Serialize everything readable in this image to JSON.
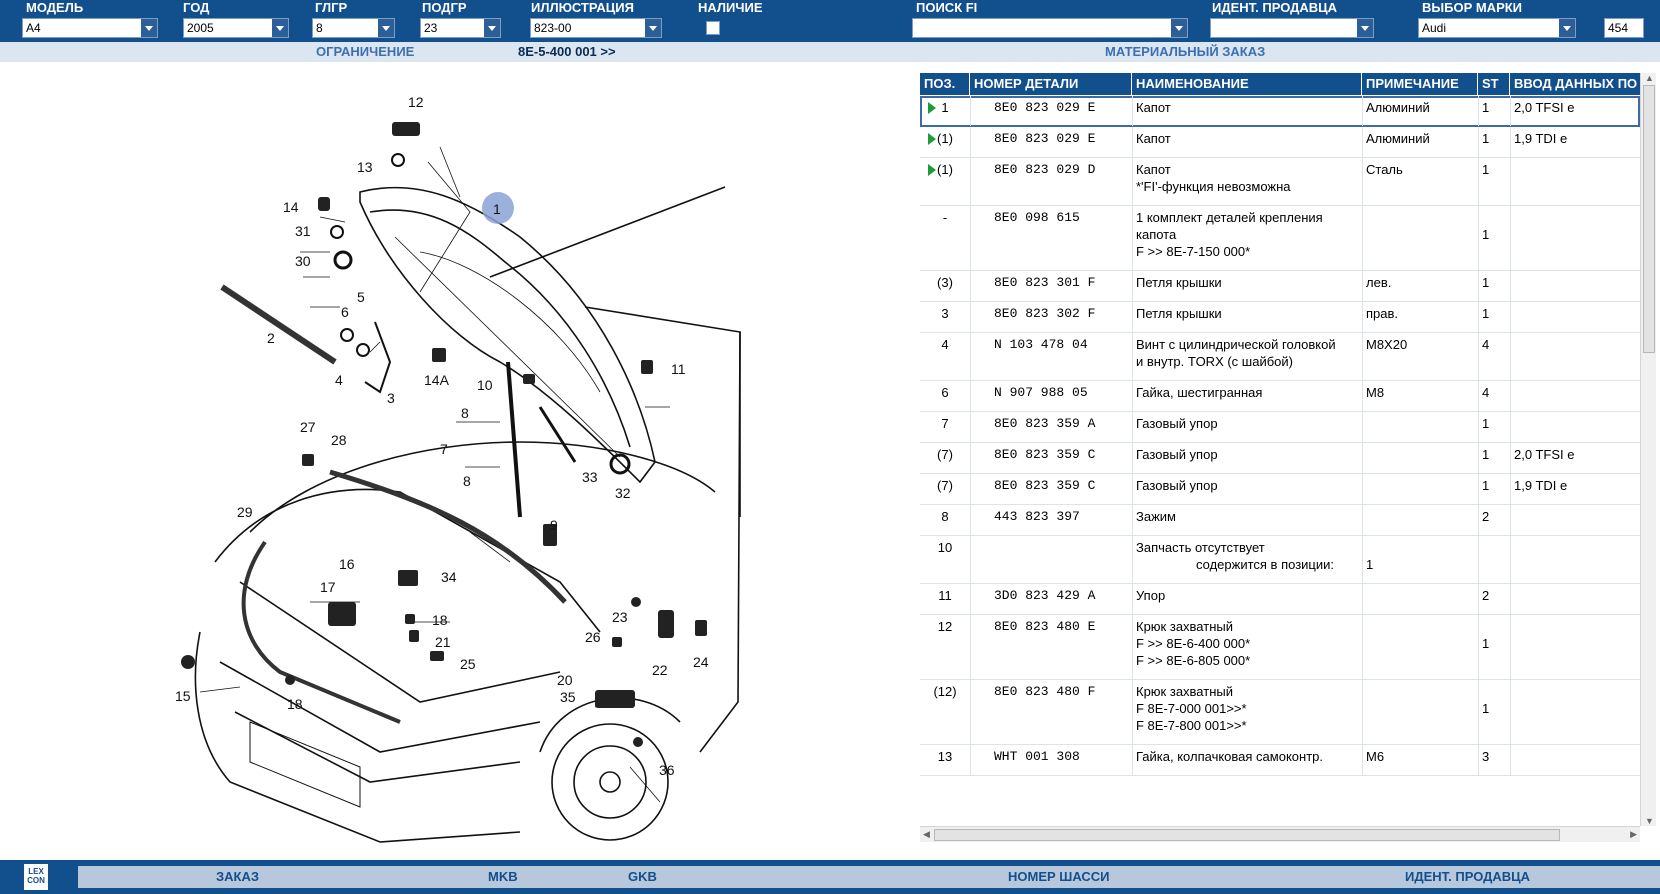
{
  "filters": {
    "model": {
      "label": "МОДЕЛЬ",
      "value": "A4"
    },
    "year": {
      "label": "ГОД",
      "value": "2005"
    },
    "main_group": {
      "label": "ГЛГР",
      "value": "8"
    },
    "sub_group": {
      "label": "ПОДГР",
      "value": "23"
    },
    "illustration": {
      "label": "ИЛЛЮСТРАЦИЯ",
      "value": "823-00"
    },
    "availability": {
      "label": "НАЛИЧИЕ"
    },
    "search_fi": {
      "label": "ПОИСК FI",
      "value": ""
    },
    "dealer_id": {
      "label": "ИДЕНТ. ПРОДАВЦА",
      "value": ""
    },
    "brand": {
      "label": "ВЫБОР МАРКИ",
      "value": "Audi"
    },
    "brand_code": "454"
  },
  "subheader": {
    "restriction_label": "ОГРАНИЧЕНИЕ",
    "restriction_value": "8E-5-400 001 >>",
    "order_title": "МАТЕРИАЛЬНЫЙ ЗАКАЗ"
  },
  "illustration": {
    "callouts": [
      "1",
      "2",
      "3",
      "4",
      "5",
      "6",
      "7",
      "8",
      "8",
      "9",
      "10",
      "11",
      "12",
      "13",
      "14",
      "14A",
      "15",
      "16",
      "17",
      "18",
      "18",
      "20",
      "21",
      "22",
      "23",
      "24",
      "25",
      "26",
      "27",
      "28",
      "29",
      "30",
      "31",
      "32",
      "33",
      "34",
      "35",
      "36"
    ]
  },
  "table": {
    "columns": [
      "ПОЗ.",
      "НОМЕР ДЕТАЛИ",
      "НАИМЕНОВАНИЕ",
      "ПРИМЕЧАНИЕ",
      "ST",
      "ВВОД ДАННЫХ ПО"
    ],
    "rows": [
      {
        "pos": "1",
        "pn": "8E0 823 029 E",
        "name": [
          "Капот"
        ],
        "note": "Алюминий",
        "st": "1",
        "input": "2,0 TFSI e",
        "marker": true
      },
      {
        "pos": "(1)",
        "pn": "8E0 823 029 E",
        "name": [
          "Капот"
        ],
        "note": "Алюминий",
        "st": "1",
        "input": "1,9 TDI e",
        "marker": true
      },
      {
        "pos": "(1)",
        "pn": "8E0 823 029 D",
        "name": [
          "Капот",
          "*'FI'-функция невозможна"
        ],
        "note": "Сталь",
        "st": "1",
        "input": "",
        "marker": true
      },
      {
        "pos": "-",
        "pn": "8E0 098 615",
        "name": [
          "1 комплект деталей крепления",
          "капота",
          "F            >> 8E-7-150 000*"
        ],
        "note": "",
        "st": "1",
        "input": "",
        "marker": false
      },
      {
        "pos": "(3)",
        "pn": "8E0 823 301 F",
        "name": [
          "Петля крышки"
        ],
        "note": "лев.",
        "st": "1",
        "input": "",
        "marker": false
      },
      {
        "pos": "3",
        "pn": "8E0 823 302 F",
        "name": [
          "Петля крышки"
        ],
        "note": "прав.",
        "st": "1",
        "input": "",
        "marker": false
      },
      {
        "pos": "4",
        "pn": "N   103 478 04",
        "name": [
          "Винт с цилиндрической головкой",
          "и внутр. TORX (с шайбой)"
        ],
        "note": "M8X20",
        "st": "4",
        "input": "",
        "marker": false
      },
      {
        "pos": "6",
        "pn": "N   907 988 05",
        "name": [
          "Гайка, шестигранная"
        ],
        "note": "M8",
        "st": "4",
        "input": "",
        "marker": false
      },
      {
        "pos": "7",
        "pn": "8E0 823 359 A",
        "name": [
          "Газовый упор"
        ],
        "note": "",
        "st": "1",
        "input": "",
        "marker": false
      },
      {
        "pos": "(7)",
        "pn": "8E0 823 359 C",
        "name": [
          "Газовый упор"
        ],
        "note": "",
        "st": "1",
        "input": "2,0 TFSI e",
        "marker": false
      },
      {
        "pos": "(7)",
        "pn": "8E0 823 359 C",
        "name": [
          "Газовый упор"
        ],
        "note": "",
        "st": "1",
        "input": "1,9 TDI e",
        "marker": false
      },
      {
        "pos": "8",
        "pn": "443 823 397",
        "name": [
          "Зажим"
        ],
        "note": "",
        "st": "2",
        "input": "",
        "marker": false
      },
      {
        "pos": "10",
        "pn": "",
        "name": [
          "Запчасть отсутствует",
          "содержится в позиции:"
        ],
        "note": "1",
        "st": "",
        "input": "",
        "marker": false
      },
      {
        "pos": "11",
        "pn": "3D0 823 429 A",
        "name": [
          "Упор"
        ],
        "note": "",
        "st": "2",
        "input": "",
        "marker": false
      },
      {
        "pos": "12",
        "pn": "8E0 823 480 E",
        "name": [
          "Крюк захватный",
          "F            >> 8E-6-400 000*",
          "F            >> 8E-6-805 000*"
        ],
        "note": "",
        "st": "1",
        "input": "",
        "marker": false
      },
      {
        "pos": "(12)",
        "pn": "8E0 823 480 F",
        "name": [
          "Крюк захватный",
          "F 8E-7-000 001>>*",
          "F 8E-7-800 001>>*"
        ],
        "note": "",
        "st": "1",
        "input": "",
        "marker": false
      },
      {
        "pos": "13",
        "pn": "WHT 001 308",
        "name": [
          "Гайка, колпачковая самоконтр."
        ],
        "note": "M6",
        "st": "3",
        "input": "",
        "marker": false
      }
    ]
  },
  "bottom": {
    "logo": "LEX CON",
    "buttons": [
      "ЗАКАЗ",
      "MKB",
      "GKB",
      "НОМЕР ШАССИ",
      "ИДЕНТ. ПРОДАВЦА"
    ]
  },
  "colors": {
    "header_blue": "#124f8d",
    "sub_blue": "#dbe6f1",
    "marker_green": "#1e9c3a"
  }
}
